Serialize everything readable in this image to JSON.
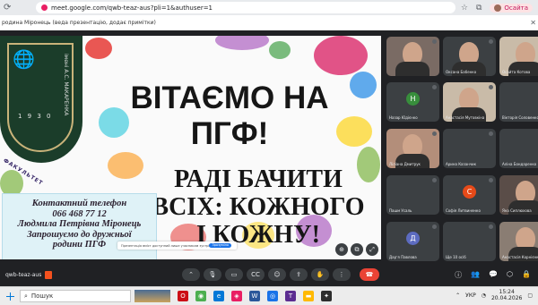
{
  "browser": {
    "url": "meet.google.com/qwb-teaz-aus?pli=1&authuser=1",
    "profile_label": "Осайта"
  },
  "bookmarks": {
    "item": "родина Міронець (вeда презентацію, додає примітки)"
  },
  "slide": {
    "title": "ВІТАЄМО НА ПГФ!",
    "subtitle": "РАДІ БАЧИТИ ВСІХ: КОЖНОГО І КОЖНУ!",
    "logo_year": "1 9 3 0",
    "logo_side_text": "імені А.С. МАКАРЕНКА",
    "logo_faculty_text": "ФАКУЛЬТЕТ",
    "contact": {
      "line1": "Контактний телефон",
      "line2": "066 468 77 12",
      "line3": "Людмила Петрівна Міронець",
      "line4": "Запрошуємо до дружньої",
      "line5": "родини ПГФ"
    },
    "notice_text": "Презентація вміст доступний лише учасникам зустрічі",
    "notice_button": "Зрозуміло"
  },
  "participants": [
    {
      "name": "",
      "initial": "",
      "color": "#7a6b64",
      "video": true
    },
    {
      "name": "Оксана Бабенко",
      "initial": "",
      "color": "#3c4043",
      "video": true
    },
    {
      "name": "Осайта Котова",
      "initial": "",
      "color": "#c9bba8",
      "video": true
    },
    {
      "name": "Назар Юдієнко",
      "initial": "Н",
      "color": "#388e3c",
      "video": false
    },
    {
      "name": "Анастасія Мутовкіна",
      "initial": "",
      "color": "#c9bba8",
      "video": true
    },
    {
      "name": "Вікторія Соловенко",
      "initial": "",
      "color": "#3c4043",
      "video": false
    },
    {
      "name": "Ліліана Дмитрук",
      "initial": "",
      "color": "#b38e7a",
      "video": true
    },
    {
      "name": "Арина Казанчик",
      "initial": "",
      "color": "#3c4043",
      "video": false
    },
    {
      "name": "Аліна Бондаренко",
      "initial": "",
      "color": "#3c4043",
      "video": false
    },
    {
      "name": "Пашм Усаль",
      "initial": "",
      "color": "#3c4043",
      "video": false
    },
    {
      "name": "Софія Литвиненко",
      "initial": "С",
      "color": "#e64a19",
      "video": false
    },
    {
      "name": "Яна Сиплюхова",
      "initial": "",
      "color": "#5a4d48",
      "video": true
    },
    {
      "name": "Дарʼя Павлова",
      "initial": "Д",
      "color": "#5c6bc0",
      "video": false
    },
    {
      "name": "Ще 10 осіб",
      "initial": "",
      "color": "#3c4043",
      "video": false
    },
    {
      "name": "Анастасія Корнієнко",
      "initial": "",
      "color": "#8a7d73",
      "video": true
    }
  ],
  "meeting": {
    "code": "qwb-teaz-aus"
  },
  "taskbar": {
    "search_placeholder": "Пошук",
    "lang": "УКР",
    "time": "15:24",
    "date": "20.04.2026"
  }
}
